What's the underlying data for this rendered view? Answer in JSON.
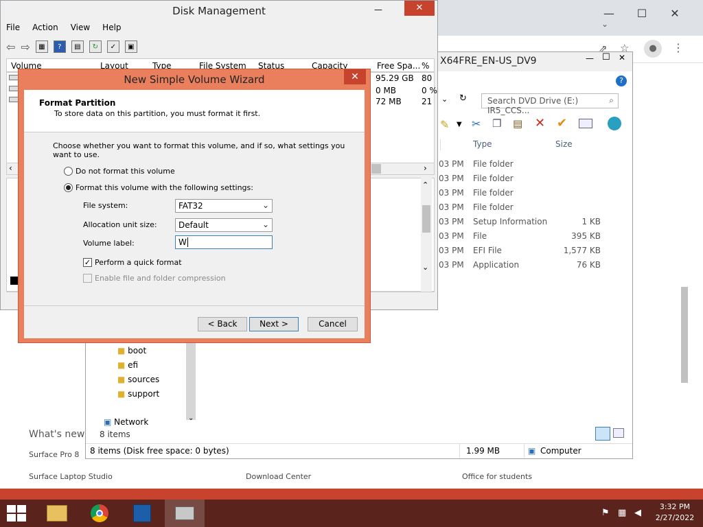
{
  "browser": {
    "window_controls": {
      "minimize": "—",
      "maximize": "☐",
      "close": "✕"
    },
    "footer": {
      "heading": "What's new",
      "links": [
        "Surface Pro 8",
        "Surface Laptop Studio",
        "Download Center",
        "Office for students"
      ]
    }
  },
  "explorer": {
    "title": "X64FRE_EN-US_DV9",
    "search_placeholder": "Search DVD Drive (E:) IR5_CCS...",
    "columns": [
      "Type",
      "Size"
    ],
    "rows": [
      {
        "time": "03 PM",
        "type": "File folder",
        "size": ""
      },
      {
        "time": "03 PM",
        "type": "File folder",
        "size": ""
      },
      {
        "time": "03 PM",
        "type": "File folder",
        "size": ""
      },
      {
        "time": "03 PM",
        "type": "File folder",
        "size": ""
      },
      {
        "time": "03 PM",
        "type": "Setup Information",
        "size": "1 KB"
      },
      {
        "time": "03 PM",
        "type": "File",
        "size": "395 KB"
      },
      {
        "time": "03 PM",
        "type": "EFI File",
        "size": "1,577 KB"
      },
      {
        "time": "03 PM",
        "type": "Application",
        "size": "76 KB"
      }
    ],
    "tree": [
      "boot",
      "efi",
      "sources",
      "support"
    ],
    "network": "Network",
    "items_count": "8 items",
    "status": {
      "left": "8 items (Disk free space: 0 bytes)",
      "size": "1.99 MB",
      "location": "Computer"
    }
  },
  "diskmgmt": {
    "title": "Disk Management",
    "menu": [
      "File",
      "Action",
      "View",
      "Help"
    ],
    "columns": [
      "Volume",
      "Layout",
      "Type",
      "File System",
      "Status",
      "Capacity",
      "Free Spa...",
      "% F"
    ],
    "free_space": [
      "95.29 GB",
      "0 MB",
      "72 MB"
    ],
    "percent_free": [
      "80",
      "0 %",
      "21"
    ]
  },
  "wizard": {
    "title": "New Simple Volume Wizard",
    "close": "✕",
    "heading": "Format Partition",
    "subheading": "To store data on this partition, you must format it first.",
    "instruction": "Choose whether you want to format this volume, and if so, what settings you want to use.",
    "option_no_format": "Do not format this volume",
    "option_format": "Format this volume with the following settings:",
    "fs_label": "File system:",
    "fs_value": "FAT32",
    "alloc_label": "Allocation unit size:",
    "alloc_value": "Default",
    "vol_label": "Volume label:",
    "vol_value": "W",
    "quick_format": "Perform a quick format",
    "compression": "Enable file and folder compression",
    "back": "< Back",
    "next": "Next >",
    "cancel": "Cancel"
  },
  "taskbar": {
    "time": "3:32 PM",
    "date": "2/27/2022"
  }
}
